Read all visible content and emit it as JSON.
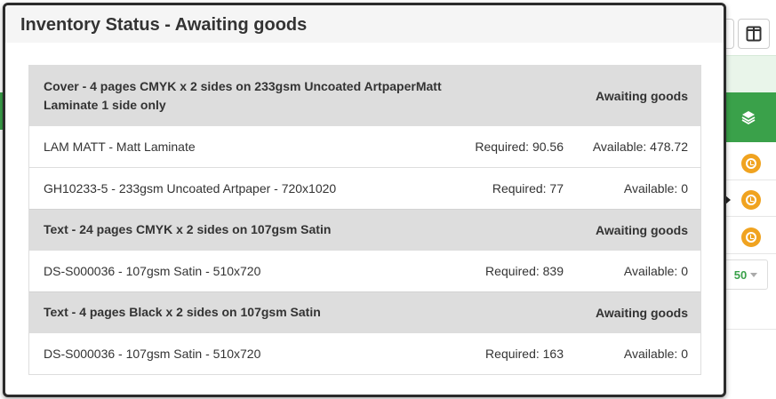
{
  "modal": {
    "title": "Inventory Status - Awaiting goods"
  },
  "groups": [
    {
      "description": "Cover - 4 pages CMYK x 2 sides on 233gsm Uncoated ArtpaperMatt Laminate 1 side only",
      "status": "Awaiting goods",
      "items": [
        {
          "description": "LAM MATT - Matt Laminate",
          "required": "Required: 90.56",
          "available": "Available: 478.72"
        },
        {
          "description": "GH10233-5 - 233gsm Uncoated Artpaper - 720x1020",
          "required": "Required: 77",
          "available": "Available: 0"
        }
      ]
    },
    {
      "description": "Text - 24 pages CMYK x 2 sides on 107gsm Satin",
      "status": "Awaiting goods",
      "items": [
        {
          "description": "DS-S000036 - 107gsm Satin - 510x720",
          "required": "Required: 839",
          "available": "Available: 0"
        }
      ]
    },
    {
      "description": "Text - 4 pages Black x 2 sides on 107gsm Satin",
      "status": "Awaiting goods",
      "items": [
        {
          "description": "DS-S000036 - 107gsm Satin - 510x720",
          "required": "Required: 163",
          "available": "Available: 0"
        }
      ]
    }
  ],
  "background": {
    "page_size_value": "50",
    "icons": [
      "layout-toggle-icon",
      "layers-icon",
      "clock-icon",
      "chevron-down-icon"
    ],
    "colors": {
      "accent_green": "#3aa14a",
      "status_orange": "#f0a320",
      "group_header_gray": "#dddddd"
    }
  }
}
